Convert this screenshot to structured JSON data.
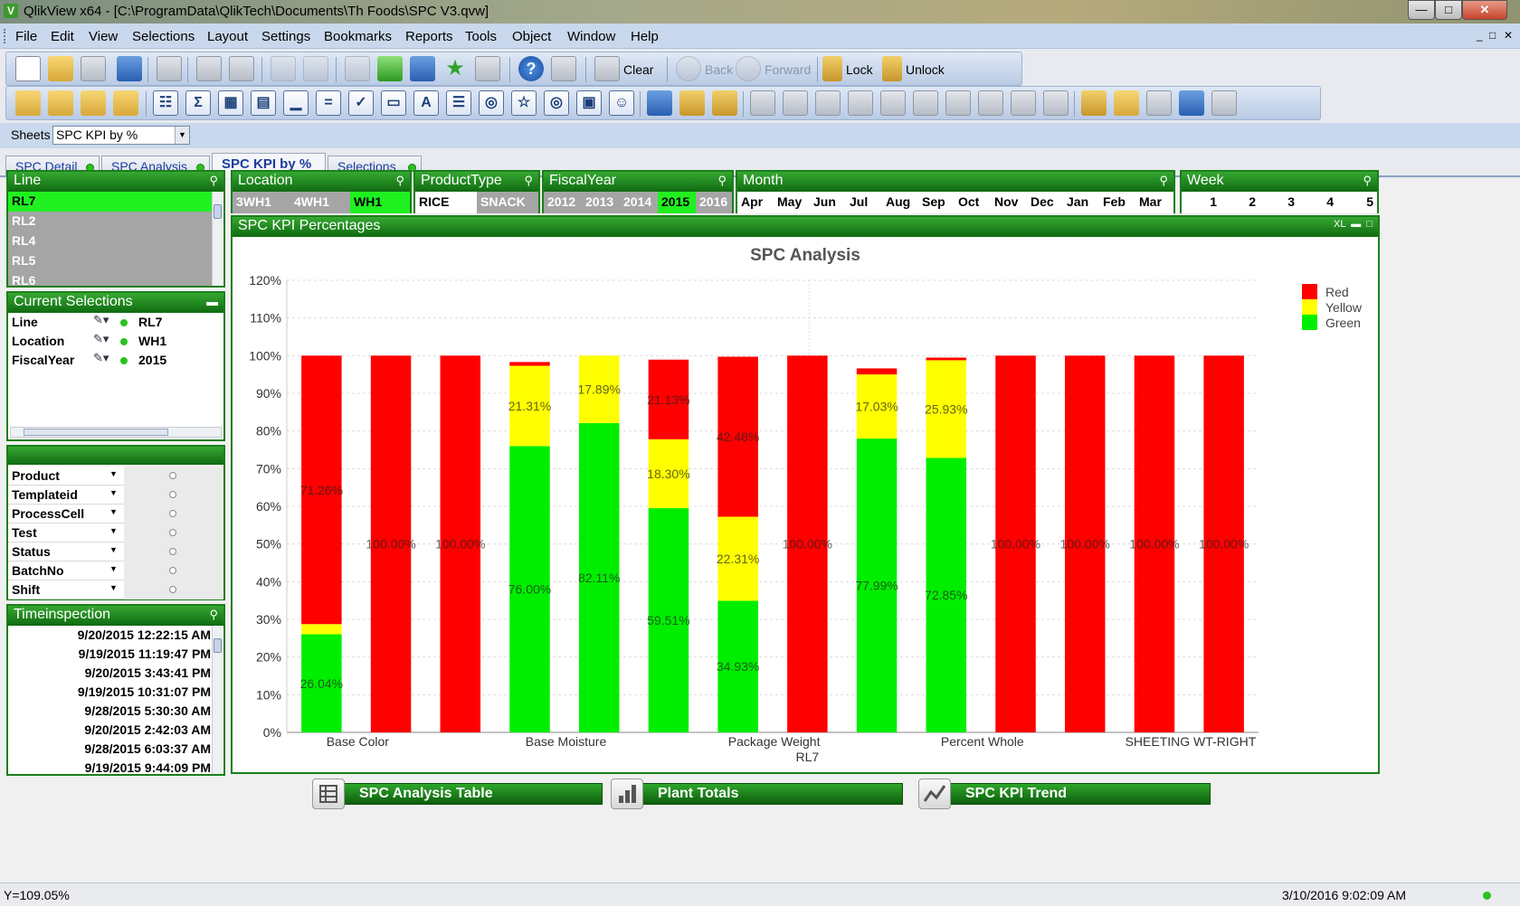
{
  "window": {
    "app_icon": "V",
    "title": "QlikView x64 - [C:\\ProgramData\\QlikTech\\Documents\\Th Foods\\SPC V3.qvw]",
    "controls": [
      "—",
      "□",
      "✕"
    ]
  },
  "menu": {
    "items": [
      "File",
      "Edit",
      "View",
      "Selections",
      "Layout",
      "Settings",
      "Bookmarks",
      "Reports",
      "Tools",
      "Object",
      "Window",
      "Help"
    ],
    "mdi": [
      "_",
      "□",
      "✕"
    ]
  },
  "toolbar": {
    "clear": "Clear",
    "back": "Back",
    "forward": "Forward",
    "lock": "Lock",
    "unlock": "Unlock",
    "design_icons": [
      "☷",
      "Σ",
      "▦",
      "▤",
      "▁",
      "=",
      "✓",
      "▭",
      "A",
      "☰",
      "◎",
      "☆",
      "◎",
      "▣",
      "☺"
    ]
  },
  "sheets": {
    "label": "Sheets",
    "selected": "SPC KPI by %",
    "tabs": [
      "SPC Detail",
      "SPC Analysis",
      "SPC KPI by %",
      "Selections"
    ],
    "active_tab": 2
  },
  "line_box": {
    "caption": "Line",
    "items": [
      {
        "label": "RL7",
        "state": "selected"
      },
      {
        "label": "RL2",
        "state": "excluded"
      },
      {
        "label": "RL4",
        "state": "excluded"
      },
      {
        "label": "RL5",
        "state": "excluded"
      },
      {
        "label": "RL6",
        "state": "excluded"
      }
    ]
  },
  "location_box": {
    "caption": "Location",
    "items": [
      {
        "label": "3WH1",
        "state": "excluded"
      },
      {
        "label": "4WH1",
        "state": "excluded"
      },
      {
        "label": "WH1",
        "state": "selected"
      }
    ]
  },
  "producttype_box": {
    "caption": "ProductType",
    "items": [
      {
        "label": "RICE",
        "state": "optional"
      },
      {
        "label": "SNACK",
        "state": "excluded"
      }
    ]
  },
  "fiscalyear_box": {
    "caption": "FiscalYear",
    "items": [
      {
        "label": "2012",
        "state": "excluded"
      },
      {
        "label": "2013",
        "state": "excluded"
      },
      {
        "label": "2014",
        "state": "excluded"
      },
      {
        "label": "2015",
        "state": "selected"
      },
      {
        "label": "2016",
        "state": "excluded"
      }
    ]
  },
  "month_box": {
    "caption": "Month",
    "items": [
      "Apr",
      "May",
      "Jun",
      "Jul",
      "Aug",
      "Sep",
      "Oct",
      "Nov",
      "Dec",
      "Jan",
      "Feb",
      "Mar"
    ]
  },
  "week_box": {
    "caption": "Week",
    "items": [
      "1",
      "2",
      "3",
      "4",
      "5"
    ]
  },
  "current_selections": {
    "caption": "Current Selections",
    "rows": [
      {
        "field": "Line",
        "value": "RL7"
      },
      {
        "field": "Location",
        "value": "WH1"
      },
      {
        "field": "FiscalYear",
        "value": "2015"
      }
    ]
  },
  "multibox": {
    "fields": [
      "Product",
      "Templateid",
      "ProcessCell",
      "Test",
      "Status",
      "BatchNo",
      "Shift"
    ]
  },
  "timeinspection": {
    "caption": "Timeinspection",
    "items": [
      "9/20/2015 12:22:15 AM",
      "9/19/2015 11:19:47 PM",
      "9/20/2015 3:43:41 PM",
      "9/19/2015 10:31:07 PM",
      "9/28/2015 5:30:30 AM",
      "9/20/2015 2:42:03 AM",
      "9/28/2015 6:03:37 AM",
      "9/19/2015 9:44:09 PM"
    ]
  },
  "chart_box": {
    "caption": "SPC KPI Percentages",
    "xl": "XL"
  },
  "chart_data": {
    "type": "bar",
    "stacked": true,
    "title": "SPC Analysis",
    "xlabel": "RL7",
    "ylabel": "",
    "ylim": [
      0,
      120
    ],
    "yticks": [
      0,
      10,
      20,
      30,
      40,
      50,
      60,
      70,
      80,
      90,
      100,
      110,
      120
    ],
    "ytick_suffix": "%",
    "grid": true,
    "legend_position": "top-right",
    "x_tick_labels": [
      {
        "label": "Base Color",
        "index": 0
      },
      {
        "label": "Base Moisture",
        "index": 3
      },
      {
        "label": "Package Weight",
        "index": 6
      },
      {
        "label": "Percent Whole",
        "index": 9
      },
      {
        "label": "SHEETING WT-RIGHT",
        "index": 12
      }
    ],
    "bar_count": 14,
    "series": [
      {
        "name": "Green",
        "color": "#00ee00",
        "values": [
          26.04,
          0,
          0,
          76.0,
          82.11,
          59.51,
          34.93,
          0,
          77.99,
          72.85,
          0,
          0,
          0,
          0
        ],
        "labels": [
          "26.04%",
          "",
          "",
          "76.00%",
          "82.11%",
          "59.51%",
          "34.93%",
          "",
          "77.99%",
          "72.85%",
          "",
          "",
          "",
          ""
        ]
      },
      {
        "name": "Yellow",
        "color": "#ffff00",
        "values": [
          2.7,
          0,
          0,
          21.31,
          17.89,
          18.3,
          22.31,
          0,
          17.03,
          25.93,
          0,
          0,
          0,
          0
        ],
        "labels": [
          "",
          "",
          "",
          "21.31%",
          "17.89%",
          "18.30%",
          "22.31%",
          "",
          "17.03%",
          "25.93%",
          "",
          "",
          "",
          ""
        ]
      },
      {
        "name": "Red",
        "color": "#ff0000",
        "values": [
          71.26,
          100,
          100,
          1.0,
          0,
          21.13,
          42.48,
          100,
          1.6,
          0.7,
          100,
          100,
          100,
          100
        ],
        "labels": [
          "71.26%",
          "100.00%",
          "100.00%",
          "",
          "",
          "21.13%",
          "42.48%",
          "100.00%",
          "",
          "",
          "100.00%",
          "100.00%",
          "100.00%",
          "100.00%"
        ]
      }
    ],
    "legend_order": [
      "Red",
      "Yellow",
      "Green"
    ]
  },
  "buttons": {
    "analysis_table": "SPC Analysis Table",
    "plant_totals": "Plant Totals",
    "kpi_trend": "SPC KPI Trend"
  },
  "status": {
    "left": "Y=109.05%",
    "right": "3/10/2016 9:02:09 AM"
  },
  "colors": {
    "selected": "#20f020",
    "excluded": "#a5a5a5",
    "caption": "#1b8a1b"
  }
}
